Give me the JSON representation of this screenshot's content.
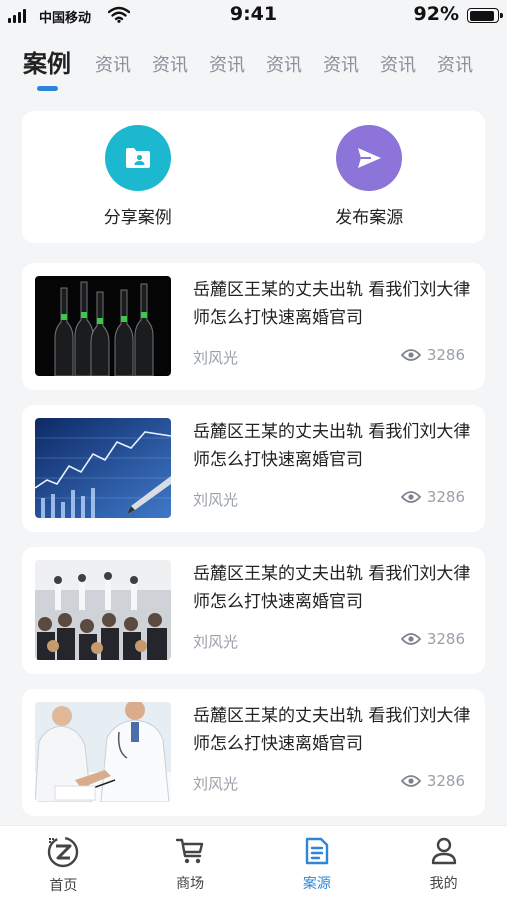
{
  "status_bar": {
    "carrier": "中国移动",
    "time": "9:41",
    "battery": "92%",
    "battery_level": 0.92
  },
  "tabs": [
    {
      "label": "案例",
      "active": true
    },
    {
      "label": "资讯"
    },
    {
      "label": "资讯"
    },
    {
      "label": "资讯"
    },
    {
      "label": "资讯"
    },
    {
      "label": "资讯"
    },
    {
      "label": "资讯"
    },
    {
      "label": "资讯"
    }
  ],
  "actions": {
    "share_case": {
      "label": "分享案例",
      "color": "#1bb8cf",
      "icon": "folder-person-icon"
    },
    "publish_case": {
      "label": "发布案源",
      "color": "#8c74d8",
      "icon": "send-icon"
    }
  },
  "articles": [
    {
      "title": "岳麓区王某的丈夫出轨 看我们刘大律师怎么打快速离婚官司",
      "author": "刘风光",
      "views": "3286",
      "image": "wine-bottles"
    },
    {
      "title": "岳麓区王某的丈夫出轨 看我们刘大律师怎么打快速离婚官司",
      "author": "刘风光",
      "views": "3286",
      "image": "stock-chart-pen"
    },
    {
      "title": "岳麓区王某的丈夫出轨 看我们刘大律师怎么打快速离婚官司",
      "author": "刘风光",
      "views": "3286",
      "image": "conference-audience"
    },
    {
      "title": "岳麓区王某的丈夫出轨 看我们刘大律师怎么打快速离婚官司",
      "author": "刘风光",
      "views": "3286",
      "image": "doctors-consultation"
    }
  ],
  "bottom_nav": [
    {
      "label": "首页",
      "icon": "home-logo-icon"
    },
    {
      "label": "商场",
      "icon": "cart-icon"
    },
    {
      "label": "案源",
      "icon": "document-icon",
      "active": true
    },
    {
      "label": "我的",
      "icon": "user-icon"
    }
  ],
  "colors": {
    "accent": "#2f86d8",
    "background": "#f4f5f7",
    "muted": "#9aa0a8"
  }
}
